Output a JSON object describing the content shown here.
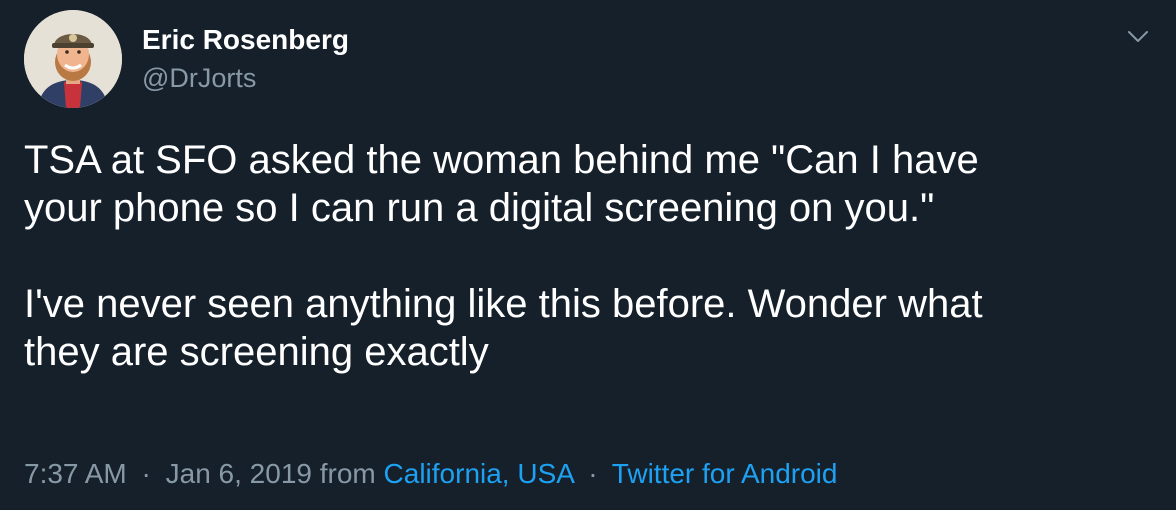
{
  "author": {
    "display_name": "Eric Rosenberg",
    "handle": "@DrJorts"
  },
  "icons": {
    "avatar": "user-avatar-illustration",
    "menu": "chevron-down-icon"
  },
  "tweet": {
    "paragraphs": [
      "TSA at SFO asked the woman behind me \"Can I have\nyour phone so I can run a digital screening on you.\"",
      "I've never seen anything like this before. Wonder what\nthey are screening exactly"
    ]
  },
  "meta": {
    "time": "7:37 AM",
    "separator": "·",
    "date": "Jan 6, 2019",
    "from_label": "from",
    "location": "California, USA",
    "source": "Twitter for Android"
  },
  "colors": {
    "background": "#15202b",
    "text_primary": "#ffffff",
    "text_secondary": "#8899a6",
    "link": "#1da1f2"
  }
}
